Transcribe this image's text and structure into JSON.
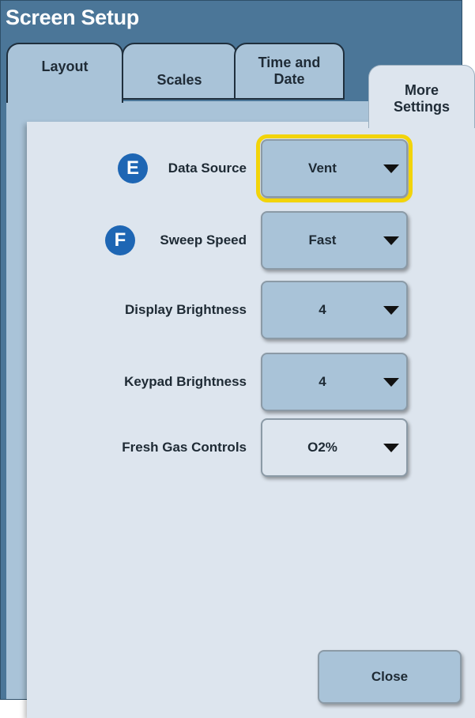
{
  "window": {
    "title": "Screen Setup"
  },
  "tabs": [
    {
      "label": "Layout"
    },
    {
      "label": "Scales"
    },
    {
      "label": "Time and Date"
    },
    {
      "label": "More Settings",
      "active": true
    }
  ],
  "settings": [
    {
      "marker": "E",
      "label": "Data Source",
      "value": "Vent",
      "highlighted": true
    },
    {
      "marker": "F",
      "label": "Sweep Speed",
      "value": "Fast"
    },
    {
      "label": "Display Brightness",
      "value": "4"
    },
    {
      "label": "Keypad Brightness",
      "value": "4"
    },
    {
      "label": "Fresh Gas Controls",
      "value": "O2%"
    }
  ],
  "close_label": "Close",
  "colors": {
    "window_bg": "#4b7698",
    "panel_bg": "#dde5ee",
    "tab_bg": "#a9c3d8",
    "highlight": "#f2d40a",
    "marker": "#1e66b4"
  }
}
